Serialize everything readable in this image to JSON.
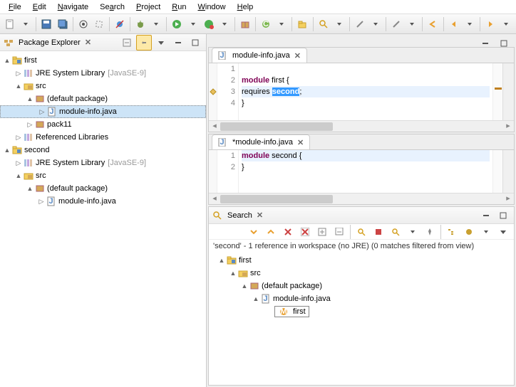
{
  "menu": {
    "file": "File",
    "edit": "Edit",
    "navigate": "Navigate",
    "search": "Search",
    "project": "Project",
    "run": "Run",
    "window": "Window",
    "help": "Help"
  },
  "explorer": {
    "title": "Package Explorer",
    "projects": [
      {
        "name": "first",
        "jre": "JRE System Library",
        "jre_tag": "[JavaSE-9]",
        "src": "src",
        "default_pkg": "(default package)",
        "module_info": "module-info.java",
        "pack": "pack11",
        "ref_libs": "Referenced Libraries"
      },
      {
        "name": "second",
        "jre": "JRE System Library",
        "jre_tag": "[JavaSE-9]",
        "src": "src",
        "default_pkg": "(default package)",
        "module_info": "module-info.java"
      }
    ]
  },
  "editor1": {
    "tab": "module-info.java",
    "lines": [
      "1",
      "2",
      "3",
      "4"
    ],
    "code": {
      "l2a": "module",
      "l2b": " first {",
      "l3a": "   requires ",
      "l3sel": "second",
      "l3b": ";",
      "l4": "}"
    }
  },
  "editor2": {
    "tab": "*module-info.java",
    "lines": [
      "1",
      "2"
    ],
    "code": {
      "l1a": "module",
      "l1b": " second {",
      "l2": "}"
    }
  },
  "search": {
    "title": "Search",
    "message": "'second' - 1 reference in workspace (no JRE) (0 matches filtered from view)",
    "tree": {
      "proj": "first",
      "src": "src",
      "pkg": "(default package)",
      "file": "module-info.java",
      "match": "first"
    }
  }
}
